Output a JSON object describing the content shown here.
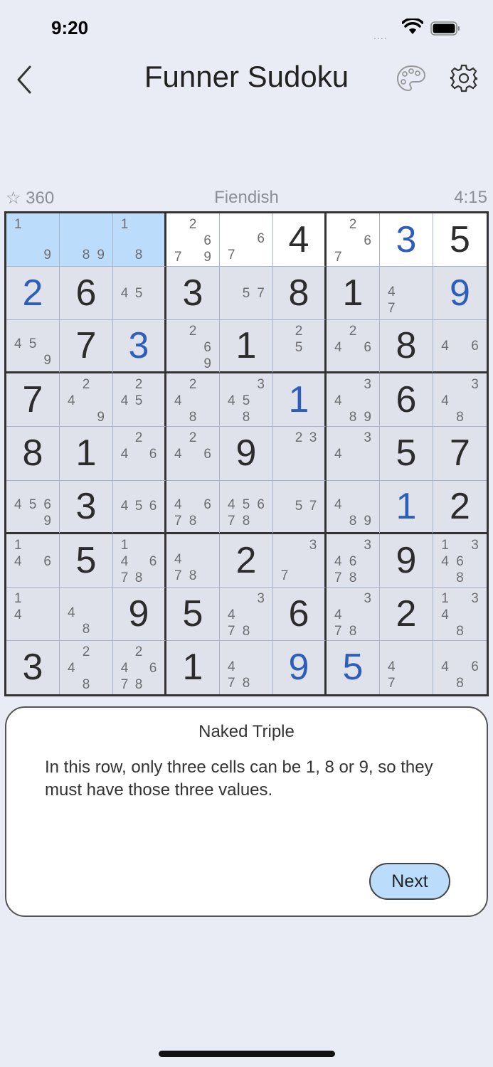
{
  "status_bar": {
    "time": "9:20",
    "signal": "....",
    "wifi_icon": "wifi-icon",
    "battery_icon": "battery-icon"
  },
  "nav": {
    "title": "Funner Sudoku",
    "back_icon": "chevron-left-icon",
    "palette_icon": "palette-icon",
    "settings_icon": "gear-icon"
  },
  "info": {
    "score": "☆ 360",
    "difficulty": "Fiendish",
    "timer": "4:15"
  },
  "colors": {
    "background": "#e9ecf4",
    "highlight": "#bcdcfc",
    "user_digit": "#2d5fba",
    "given_digit": "#2c2c2c"
  },
  "board": {
    "rows": [
      [
        {
          "n": "1.......9",
          "s": "h"
        },
        {
          "n": ".......89",
          "s": "h"
        },
        {
          "n": "1......8.",
          "s": "h"
        },
        {
          "n": ".2...67.9",
          "s": "w"
        },
        {
          "n": ".....67..",
          "s": "w"
        },
        {
          "v": "4",
          "s": "w"
        },
        {
          "n": ".2...67..",
          "s": "w"
        },
        {
          "v": "3",
          "u": true,
          "s": "w"
        },
        {
          "v": "5",
          "s": "w"
        }
      ],
      [
        {
          "v": "2",
          "u": true
        },
        {
          "v": "6"
        },
        {
          "n": "...45...."
        },
        {
          "v": "3"
        },
        {
          "n": "....57..."
        },
        {
          "v": "8"
        },
        {
          "v": "1"
        },
        {
          "n": "...4..7.."
        },
        {
          "v": "9",
          "u": true
        }
      ],
      [
        {
          "n": "...45...9"
        },
        {
          "v": "7"
        },
        {
          "v": "3",
          "u": true
        },
        {
          "n": ".2...6..9"
        },
        {
          "v": "1"
        },
        {
          "n": ".2..5...."
        },
        {
          "n": ".2.4.6..."
        },
        {
          "v": "8"
        },
        {
          "n": "...4.6..."
        }
      ],
      [
        {
          "v": "7"
        },
        {
          "n": ".2.4....9"
        },
        {
          "n": ".2.45...."
        },
        {
          "n": ".2.4...8."
        },
        {
          "n": "..345..8."
        },
        {
          "v": "1",
          "u": true
        },
        {
          "n": "..34...89"
        },
        {
          "v": "6"
        },
        {
          "n": "..34...8."
        }
      ],
      [
        {
          "v": "8"
        },
        {
          "v": "1"
        },
        {
          "n": ".2.4.6..."
        },
        {
          "n": ".2.4.6..."
        },
        {
          "v": "9"
        },
        {
          "n": ".23......"
        },
        {
          "n": "..34....."
        },
        {
          "v": "5"
        },
        {
          "v": "7"
        }
      ],
      [
        {
          "n": "...456..9"
        },
        {
          "v": "3"
        },
        {
          "n": "...456..."
        },
        {
          "n": "...4.678."
        },
        {
          "n": "...45678."
        },
        {
          "n": "....57..."
        },
        {
          "n": "...4...89"
        },
        {
          "v": "1",
          "u": true
        },
        {
          "v": "2"
        }
      ],
      [
        {
          "n": "1..4.6..."
        },
        {
          "v": "5"
        },
        {
          "n": "1..4.678."
        },
        {
          "n": "...4..78."
        },
        {
          "v": "2"
        },
        {
          "n": "..3...7.."
        },
        {
          "n": "..346.78."
        },
        {
          "v": "9"
        },
        {
          "n": "1.346..8."
        }
      ],
      [
        {
          "n": "1..4....."
        },
        {
          "n": "...4...8."
        },
        {
          "v": "9"
        },
        {
          "v": "5"
        },
        {
          "n": "..34..78."
        },
        {
          "v": "6"
        },
        {
          "n": "..34..78."
        },
        {
          "v": "2"
        },
        {
          "n": "1.34...8."
        }
      ],
      [
        {
          "v": "3"
        },
        {
          "n": ".2.4...8."
        },
        {
          "n": ".2.4.678."
        },
        {
          "v": "1"
        },
        {
          "n": "...4..78."
        },
        {
          "v": "9",
          "u": true
        },
        {
          "v": "5",
          "u": true
        },
        {
          "n": "...4..7.."
        },
        {
          "n": "...4.6.8."
        }
      ]
    ]
  },
  "hint": {
    "title": "Naked Triple",
    "text": "In this row, only three cells can be 1, 8 or 9, so they must have those three values.",
    "next_label": "Next"
  }
}
